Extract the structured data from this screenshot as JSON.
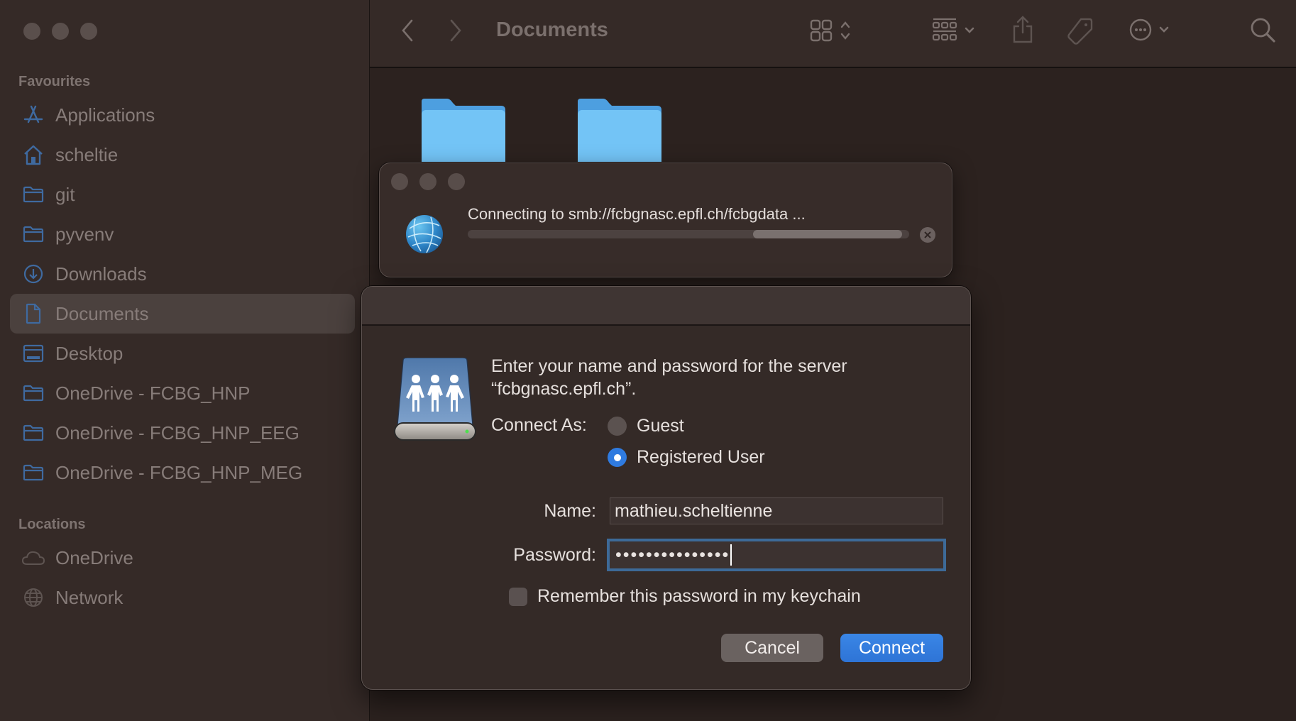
{
  "window": {
    "title": "Documents"
  },
  "sidebar": {
    "sections": [
      {
        "heading": "Favourites",
        "items": [
          {
            "label": "Applications",
            "icon": "applications-icon",
            "selected": false
          },
          {
            "label": "scheltie",
            "icon": "home-icon",
            "selected": false
          },
          {
            "label": "git",
            "icon": "folder-icon",
            "selected": false
          },
          {
            "label": "pyvenv",
            "icon": "folder-icon",
            "selected": false
          },
          {
            "label": "Downloads",
            "icon": "download-icon",
            "selected": false
          },
          {
            "label": "Documents",
            "icon": "document-icon",
            "selected": true
          },
          {
            "label": "Desktop",
            "icon": "desktop-icon",
            "selected": false
          },
          {
            "label": "OneDrive - FCBG_HNP",
            "icon": "folder-icon",
            "selected": false
          },
          {
            "label": "OneDrive - FCBG_HNP_EEG",
            "icon": "folder-icon",
            "selected": false
          },
          {
            "label": "OneDrive - FCBG_HNP_MEG",
            "icon": "folder-icon",
            "selected": false
          }
        ]
      },
      {
        "heading": "Locations",
        "items": [
          {
            "label": "OneDrive",
            "icon": "cloud-icon",
            "selected": false
          },
          {
            "label": "Network",
            "icon": "globe-icon",
            "selected": false
          }
        ]
      }
    ]
  },
  "toolbar": {
    "back": "back-icon",
    "forward": "forward-icon",
    "title": "Documents",
    "icons": [
      "icon-view-icon",
      "group-icon",
      "share-icon",
      "tag-icon",
      "more-icon",
      "search-icon"
    ]
  },
  "connecting": {
    "message": "Connecting to smb://fcbgnasc.epfl.ch/fcbgdata ...",
    "progress_indeterminate": true
  },
  "auth_dialog": {
    "message_line1": "Enter your name and password for the server",
    "message_line2": "“fcbgnasc.epfl.ch”.",
    "connect_as_label": "Connect As:",
    "options": [
      {
        "label": "Guest",
        "selected": false
      },
      {
        "label": "Registered User",
        "selected": true
      }
    ],
    "name_label": "Name:",
    "name_value": "mathieu.scheltienne",
    "password_label": "Password:",
    "password_mask": "•••••••••••••••",
    "remember_label": "Remember this password in my keychain",
    "remember_checked": false,
    "cancel_label": "Cancel",
    "connect_label": "Connect"
  },
  "colors": {
    "accent": "#2f7be0",
    "sidebar_icon": "#3f6aa0",
    "folder": "#6ec2f5"
  }
}
